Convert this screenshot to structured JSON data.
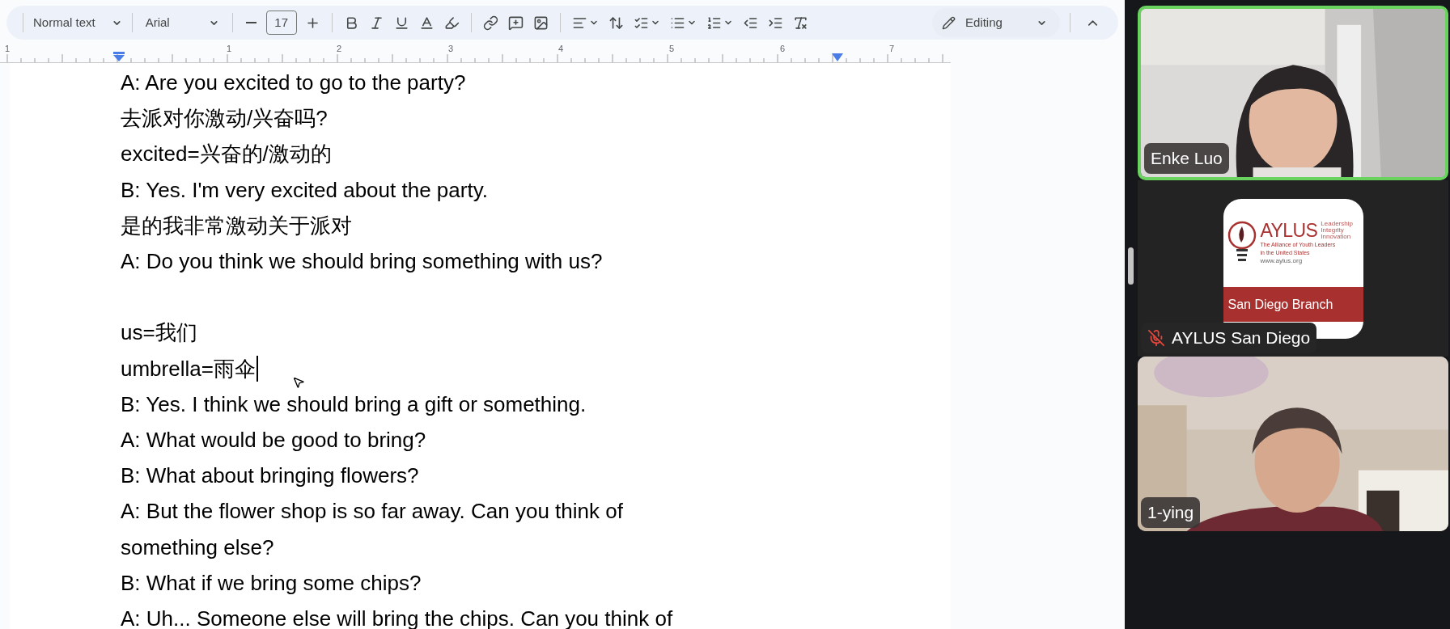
{
  "toolbar": {
    "paragraph_style": "Normal text",
    "font": "Arial",
    "font_size": "17",
    "mode": "Editing"
  },
  "ruler": {
    "labels": [
      "1",
      "1",
      "2",
      "3",
      "4",
      "5",
      "6",
      "7"
    ]
  },
  "document": {
    "lines": [
      {
        "text": "A: Are you excited to go to the party?",
        "blank_before": false,
        "caret": false
      },
      {
        "text": "去派对你激动/兴奋吗?",
        "blank_before": false,
        "caret": false
      },
      {
        "text": "excited=兴奋的/激动的",
        "blank_before": false,
        "caret": false
      },
      {
        "text": "B: Yes. I'm very excited about the party.",
        "blank_before": false,
        "caret": false
      },
      {
        "text": "是的我非常激动关于派对",
        "blank_before": false,
        "caret": false
      },
      {
        "text": "A: Do you think we should bring something with us?",
        "blank_before": false,
        "caret": false
      },
      {
        "text": "us=我们",
        "blank_before": true,
        "caret": false
      },
      {
        "text": "umbrella=雨伞",
        "blank_before": false,
        "caret": true
      },
      {
        "text": "B: Yes. I think we should bring a gift or something.",
        "blank_before": false,
        "caret": false
      },
      {
        "text": "A: What would be good to bring?",
        "blank_before": false,
        "caret": false
      },
      {
        "text": "B: What about bringing flowers?",
        "blank_before": false,
        "caret": false
      },
      {
        "text": "A: But the flower shop is so far away. Can you think of",
        "blank_before": false,
        "caret": false
      },
      {
        "text": "something else?",
        "blank_before": false,
        "caret": false
      },
      {
        "text": "B: What if we bring some chips?",
        "blank_before": false,
        "caret": false
      },
      {
        "text": "A: Uh... Someone else will bring the chips. Can you think of",
        "blank_before": false,
        "caret": false
      }
    ]
  },
  "participants": [
    {
      "kind": "video",
      "name": "Enke Luo",
      "speaking": true,
      "muted": false
    },
    {
      "kind": "logo",
      "name": "AYLUS San Diego",
      "speaking": false,
      "muted": true,
      "logo": {
        "title": "AYLUS",
        "motto": [
          "Leadership",
          "Integrity",
          "Innovation"
        ],
        "subtitle": [
          "The Alliance of Youth Leaders",
          "in the United States"
        ],
        "url": "www.aylus.org",
        "branch": "San Diego Branch"
      }
    },
    {
      "kind": "video",
      "name": "1-ying",
      "speaking": false,
      "muted": false
    }
  ]
}
